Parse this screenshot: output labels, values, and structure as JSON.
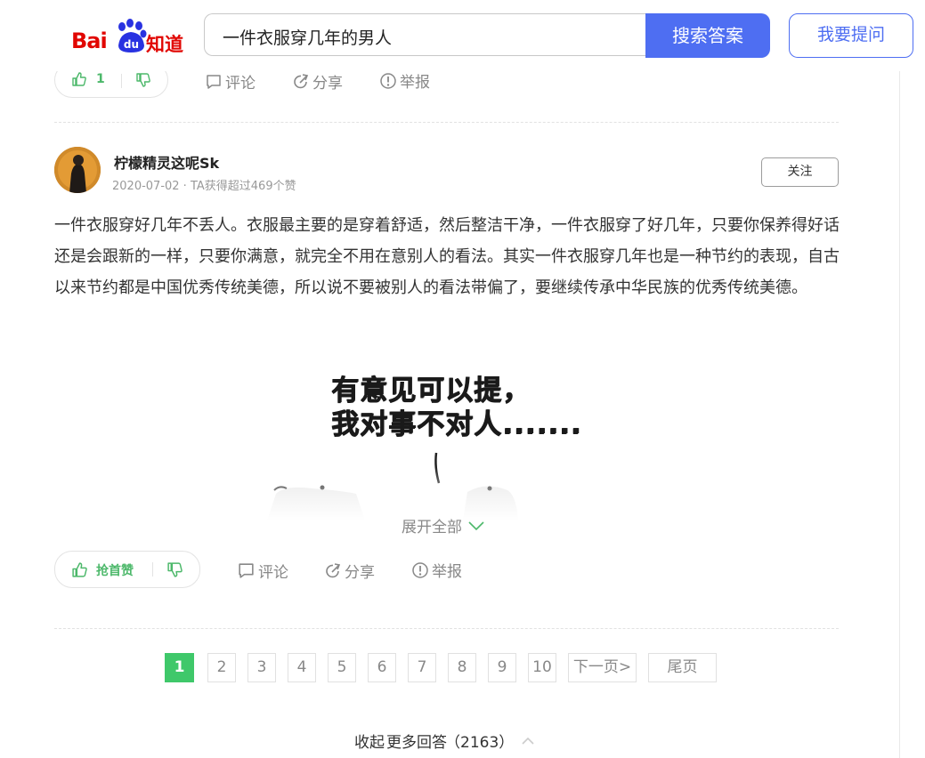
{
  "header": {
    "logo_bai": "Bai",
    "logo_du": "du",
    "logo_zhidao": "知道",
    "search_value": "一件衣服穿几年的男人",
    "search_button": "搜索答案",
    "ask_button": "我要提问"
  },
  "prev_answer": {
    "likes": "1",
    "comment_label": "评论",
    "share_label": "分享",
    "report_label": "举报"
  },
  "answer": {
    "username": "柠檬精灵这呢Sk",
    "meta": "2020-07-02 · TA获得超过469个赞",
    "follow_label": "关注",
    "text": "一件衣服穿好几年不丢人。衣服最主要的是穿着舒适，然后整洁干净，一件衣服穿了好几年，只要你保养得好话还是会跟新的一样，只要你满意，就完全不用在意别人的看法。其实一件衣服穿几年也是一种节约的表现，自古以来节约都是中国优秀传统美德，所以说不要被别人的看法带偏了，要继续传承中华民族的优秀传统美德。",
    "meme_line1": "有意见可以提，",
    "meme_line2": "我对事不对人.......",
    "expand_label": "展开全部",
    "first_like_label": "抢首赞",
    "comment_label": "评论",
    "share_label": "分享",
    "report_label": "举报"
  },
  "pagination": {
    "pages": [
      "1",
      "2",
      "3",
      "4",
      "5",
      "6",
      "7",
      "8",
      "9",
      "10"
    ],
    "current": "1",
    "next_label": "下一页>",
    "last_label": "尾页"
  },
  "footer": {
    "collapse_label": "收起",
    "more_answers_label": "更多回答",
    "more_answers_count": "（2163）"
  },
  "colors": {
    "brand_blue": "#4e6ef2",
    "baidu_red": "#e10602",
    "pager_active": "#3fc86a",
    "like_green": "#4cb86a"
  },
  "icons": [
    "thumbs-up-icon",
    "thumbs-down-icon",
    "comment-icon",
    "share-icon",
    "report-icon",
    "chevron-down-icon",
    "chevron-up-icon"
  ]
}
